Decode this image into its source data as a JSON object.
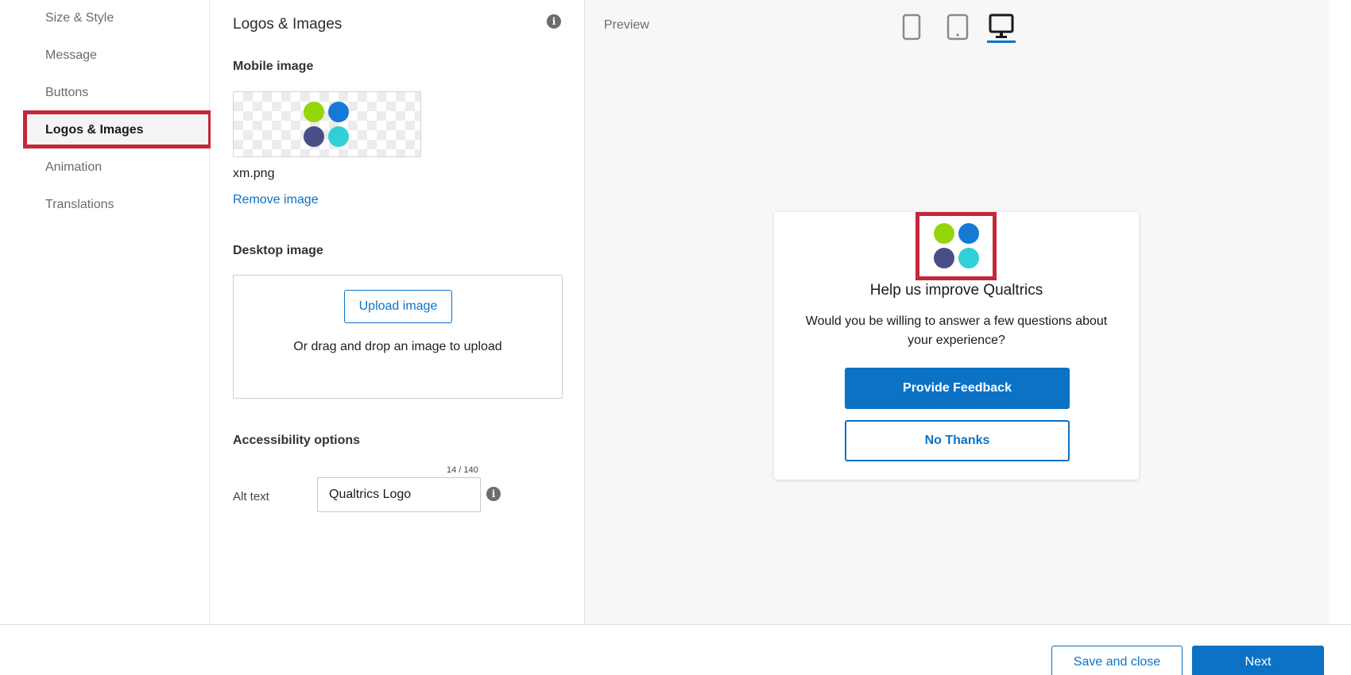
{
  "nav": {
    "items": [
      {
        "label": "Size & Style"
      },
      {
        "label": "Message"
      },
      {
        "label": "Buttons"
      },
      {
        "label": "Logos & Images",
        "active": true
      },
      {
        "label": "Animation"
      },
      {
        "label": "Translations"
      }
    ]
  },
  "settings": {
    "title": "Logos & Images",
    "info_icon": "info-icon",
    "mobile_image": {
      "label": "Mobile image",
      "filename": "xm.png",
      "remove_label": "Remove image"
    },
    "desktop_image": {
      "label": "Desktop image",
      "upload_label": "Upload image",
      "drop_text": "Or drag and drop an image to upload"
    },
    "accessibility": {
      "label": "Accessibility options",
      "alt_label": "Alt text",
      "alt_value": "Qualtrics Logo",
      "counter": "14 / 140"
    }
  },
  "preview": {
    "label": "Preview",
    "devices": [
      "mobile-icon",
      "tablet-icon",
      "desktop-icon"
    ],
    "selected_device": "desktop",
    "card": {
      "heading": "Help us improve Qualtrics",
      "body": "Would you be willing to answer a few questions about your experience?",
      "primary_button": "Provide Feedback",
      "secondary_button": "No Thanks"
    }
  },
  "logo_colors": [
    "#94d60a",
    "#1579d6",
    "#494f86",
    "#2fd0d6"
  ],
  "highlight_color": "#c4273a",
  "accent_color": "#0b72c6",
  "footer": {
    "save_label": "Save and close",
    "next_label": "Next"
  }
}
